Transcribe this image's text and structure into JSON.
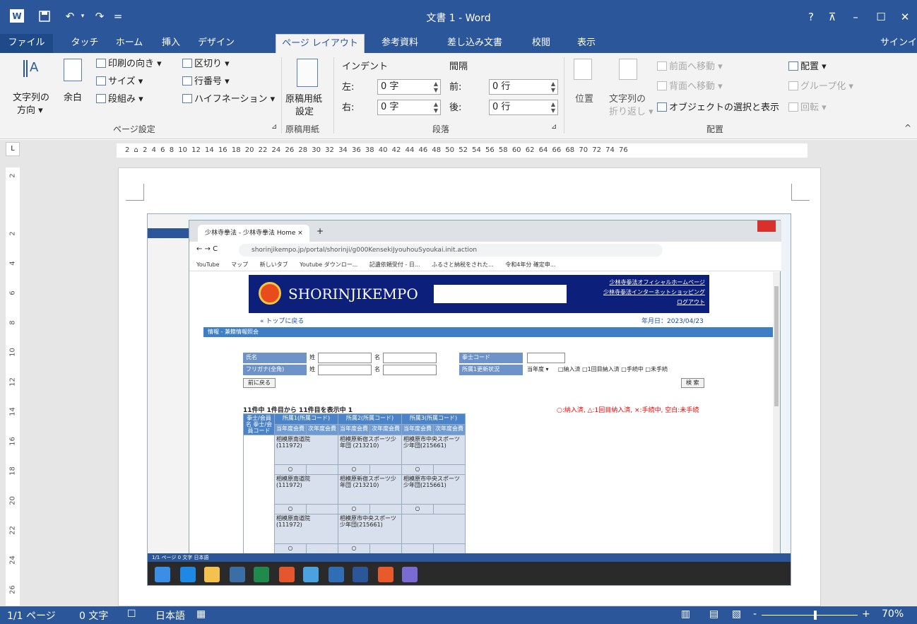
{
  "window": {
    "title": "文書 1 - Word",
    "help": "?",
    "ribbon_display": "⊼",
    "minimize": "–",
    "maximize": "☐",
    "close": "✕"
  },
  "quick_access": {
    "undo": "↶",
    "redo": "↷",
    "customize": "="
  },
  "tabs": {
    "file": "ファイル",
    "touch": "タッチ",
    "home": "ホーム",
    "insert": "挿入",
    "design": "デザイン",
    "layout": "ページ レイアウト",
    "references": "参考資料",
    "mailings": "差し込み文書",
    "review": "校閲",
    "view": "表示",
    "signin": "サインイ"
  },
  "ribbon": {
    "page_setup": {
      "text_direction": "文字列の",
      "text_direction_2": "方向 ▾",
      "margins": "余白",
      "orientation": "印刷の向き ▾",
      "size": "サイズ ▾",
      "columns": "段組み ▾",
      "breaks": "区切り ▾",
      "line_numbers": "行番号 ▾",
      "hyphenation": "ハイフネーション ▾",
      "label": "ページ設定"
    },
    "genko": {
      "settings": "原稿用紙",
      "settings_2": "設定",
      "label": "原稿用紙"
    },
    "paragraph": {
      "indent_title": "インデント",
      "spacing_title": "間隔",
      "left_label": "左:",
      "left_value": "0 字",
      "right_label": "右:",
      "right_value": "0 字",
      "before_label": "前:",
      "before_value": "0 行",
      "after_label": "後:",
      "after_value": "0 行",
      "label": "段落"
    },
    "arrange": {
      "position": "位置",
      "wrap_text": "文字列の",
      "wrap_text_2": "折り返し ▾",
      "bring_forward": "前面へ移動 ▾",
      "send_backward": "背面へ移動 ▾",
      "selection_pane": "オブジェクトの選択と表示",
      "align": "配置 ▾",
      "group": "グループ化 ▾",
      "rotate": "回転 ▾",
      "label": "配置"
    }
  },
  "ruler": {
    "tab_selector": "L",
    "h_marks": "2 ⌂ 2 4 6 8 10 12 14 16 18 20 22 24 26 28 30 32 34 36 38 40 42 44 46 48 50 52 54 56 58 60 62 64 66 68 70 72 74 76",
    "v_marks": [
      "2",
      "2",
      "4",
      "6",
      "8",
      "10",
      "12",
      "14",
      "16",
      "18",
      "20",
      "22",
      "24",
      "26"
    ]
  },
  "embedded": {
    "browser_tab": "少林寺拳法 - 少林寺拳法 Home ×",
    "new_tab": "+",
    "nav": "← → C",
    "url": "shorinjikempo.jp/portal/shorinji/g000KensekiJyouhouSyoukai.init.action",
    "bookmarks": [
      "YouTube",
      "マップ",
      "新しいタブ",
      "Youtube ダウンロー...",
      "記遺依頼受付 - 日...",
      "ふるさと納税をされた...",
      "令和4年分 確定申..."
    ],
    "brand": "SHORINJIKEMPO",
    "links": [
      "少林寺拳法オフィシャルホームページ",
      "少林寺拳法インターネットショッピング",
      "ログアウト"
    ],
    "back": "« トップに戻る",
    "date": "年月日：2023/04/23",
    "panel_title": "情報 - 兼籍情報照会",
    "form": {
      "name": "氏名",
      "kana": "フリガナ(全角)",
      "sei": "姓",
      "mei": "名",
      "code": "拳士コード",
      "status": "所属1更新状況",
      "year": "当年度 ▾",
      "checks": "□納入済 □1回目納入済 □手続中 □未手続",
      "prev": "前に戻る",
      "search": "検 索"
    },
    "count": "11件中 1件目から 11件目を表示中  1",
    "legend": "○:納入済, △:1回目納入済, ×:手続中, 空白:未手続",
    "table": {
      "col0": "拳士/会員名 拳士/会員コード",
      "col1": "所属1(所属コード)",
      "col2": "所属2(所属コード)",
      "col3": "所属3(所属コード)",
      "sub1": "当年度会費",
      "sub2": "次年度会費",
      "rows": [
        [
          "相模原南道院 (111972)",
          "相模原新宿スポーツ少年団 (213210)",
          "相模原市中央スポーツ少年団(215661)"
        ],
        [
          "相模原南道院 (111972)",
          "相模原新宿スポーツ少年団 (213210)",
          "相模原市中央スポーツ少年団(215661)"
        ],
        [
          "相模原南道院 (111972)",
          "相模原市中央スポーツ少年団(215661)",
          ""
        ]
      ],
      "mark": "○"
    },
    "status": "1/1 ページ   0 文字   日本語"
  },
  "statusbar": {
    "page": "1/1 ページ",
    "words": "0 文字",
    "language": "日本語",
    "minus": "-",
    "plus": "+",
    "zoom": "70%"
  }
}
